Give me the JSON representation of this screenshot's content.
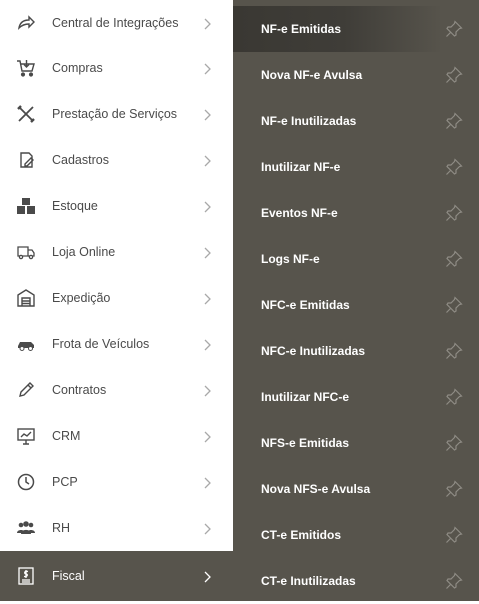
{
  "sidebar": {
    "items": [
      {
        "label": "Central de Integrações",
        "icon": "share-arrow-icon"
      },
      {
        "label": "Compras",
        "icon": "shopping-cart-icon"
      },
      {
        "label": "Prestação de Serviços",
        "icon": "tools-icon"
      },
      {
        "label": "Cadastros",
        "icon": "edit-document-icon"
      },
      {
        "label": "Estoque",
        "icon": "boxes-icon"
      },
      {
        "label": "Loja Online",
        "icon": "delivery-truck-icon"
      },
      {
        "label": "Expedição",
        "icon": "warehouse-icon"
      },
      {
        "label": "Frota de Veículos",
        "icon": "car-icon"
      },
      {
        "label": "Contratos",
        "icon": "pen-icon"
      },
      {
        "label": "CRM",
        "icon": "monitor-icon"
      },
      {
        "label": "PCP",
        "icon": "clock-icon"
      },
      {
        "label": "RH",
        "icon": "people-icon"
      },
      {
        "label": "Fiscal",
        "icon": "tax-document-icon",
        "active": true
      }
    ]
  },
  "submenu": {
    "items": [
      {
        "label": "NF-e Emitidas",
        "highlighted": true
      },
      {
        "label": "Nova NF-e Avulsa"
      },
      {
        "label": "NF-e Inutilizadas"
      },
      {
        "label": "Inutilizar NF-e"
      },
      {
        "label": "Eventos NF-e"
      },
      {
        "label": "Logs NF-e"
      },
      {
        "label": "NFC-e Emitidas"
      },
      {
        "label": "NFC-e Inutilizadas"
      },
      {
        "label": "Inutilizar NFC-e"
      },
      {
        "label": "NFS-e Emitidas"
      },
      {
        "label": "Nova NFS-e Avulsa"
      },
      {
        "label": "CT-e Emitidos"
      },
      {
        "label": "CT-e Inutilizadas"
      }
    ],
    "pin_icon": "pin-icon"
  },
  "colors": {
    "submenu_bg": "#57544c",
    "highlight_bg": "#3a3833",
    "sidebar_text": "#4a4a4a",
    "chevron": "#a9a9a9"
  }
}
